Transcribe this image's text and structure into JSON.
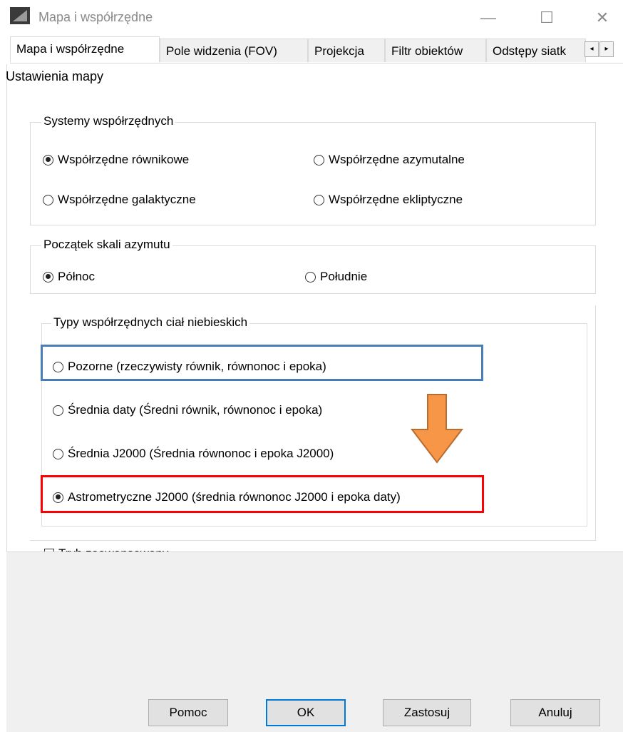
{
  "window": {
    "title": "Mapa i współrzędne",
    "minimize_glyph": "—",
    "maximize_glyph": "☐",
    "close_glyph": "✕"
  },
  "tabs": [
    {
      "label": "Mapa i współrzędne",
      "active": true
    },
    {
      "label": "Pole widzenia (FOV)",
      "active": false
    },
    {
      "label": "Projekcja",
      "active": false
    },
    {
      "label": "Filtr obiektów",
      "active": false
    },
    {
      "label": "Odstępy siatk",
      "active": false
    }
  ],
  "tab_scroll": {
    "left": "◂",
    "right": "▸"
  },
  "settings_heading": "Ustawienia mapy",
  "coordinate_systems": {
    "title": "Systemy współrzędnych",
    "options": [
      {
        "label": "Współrzędne równikowe",
        "checked": true
      },
      {
        "label": "Współrzędne azymutalne",
        "checked": false
      },
      {
        "label": "Współrzędne galaktyczne",
        "checked": false
      },
      {
        "label": "Współrzędne ekliptyczne",
        "checked": false
      }
    ]
  },
  "azimuth_origin": {
    "title": "Początek skali azymutu",
    "options": [
      {
        "label": "Północ",
        "checked": true
      },
      {
        "label": "Południe",
        "checked": false
      }
    ]
  },
  "celestial_types": {
    "title": "Typy współrzędnych ciał niebieskich",
    "options": [
      {
        "label": "Pozorne (rzeczywisty równik, równonoc i epoka)",
        "checked": false
      },
      {
        "label": "Średnia daty (Średni równik, równonoc i epoka)",
        "checked": false
      },
      {
        "label": "Średnia J2000 (Średnia równonoc i epoka J2000)",
        "checked": false
      },
      {
        "label": "Astrometryczne J2000 (średnia równonoc J2000 i epoka daty)",
        "checked": true
      }
    ]
  },
  "advanced_mode": {
    "label": "Tryb zaawansowany",
    "checked": false
  },
  "buttons": {
    "help": "Pomoc",
    "ok": "OK",
    "apply": "Zastosuj",
    "cancel": "Anuluj"
  },
  "colors": {
    "highlight_blue": "#4a7ebb",
    "highlight_red": "#ff0000",
    "arrow_orange": "#f79646",
    "arrow_outline": "#b66d31"
  }
}
